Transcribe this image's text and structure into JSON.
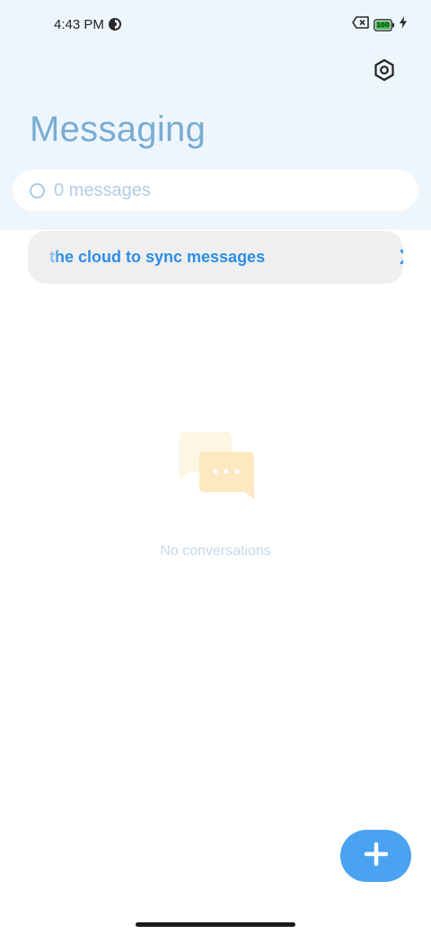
{
  "status_bar": {
    "time": "4:43 PM",
    "privacy_icon": "privacy-indicator-icon",
    "sim_icon": "no-sim-icon",
    "battery_level": "100",
    "battery_color": "#39b54a",
    "charging_icon": "charging-bolt-icon"
  },
  "header": {
    "title": "Messaging",
    "settings_icon": "settings-hexagon-icon"
  },
  "search": {
    "placeholder": "0 messages"
  },
  "sync_banner": {
    "text": "the cloud to sync messages",
    "chevron_icon": "chevron-right-icon"
  },
  "empty_state": {
    "illustration": "chat-bubbles-icon",
    "text": "No conversations"
  },
  "fab": {
    "icon": "plus-icon",
    "color": "#4aa3f0"
  },
  "colors": {
    "header_bg": "#eef6fd",
    "title": "#79acd3",
    "accent": "#2c8ee8"
  }
}
